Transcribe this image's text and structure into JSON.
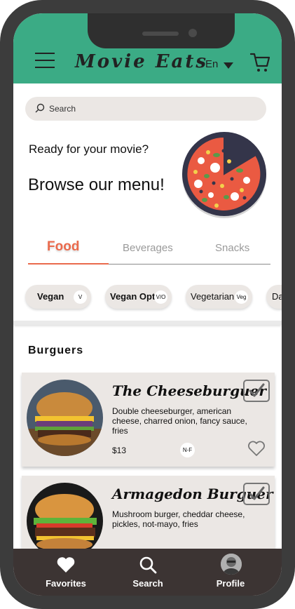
{
  "header": {
    "app_title": "Movie Eats",
    "language": "En",
    "accent_color": "#3bab85"
  },
  "search": {
    "placeholder": "Search"
  },
  "hero": {
    "greeting": "Ready for your movie?",
    "headline": "Browse our menu!",
    "image_icon": "pizza-illustration"
  },
  "tabs": [
    {
      "label": "Food",
      "active": true
    },
    {
      "label": "Beverages",
      "active": false
    },
    {
      "label": "Snacks",
      "active": false
    }
  ],
  "filters": [
    {
      "label": "Vegan",
      "badge": "V"
    },
    {
      "label": "Vegan Opt",
      "badge": "V/O"
    },
    {
      "label": "Vegetarian",
      "badge": "Veg"
    },
    {
      "label": "Da",
      "badge": ""
    }
  ],
  "section": {
    "title": "Burguers"
  },
  "items": [
    {
      "name": "The Cheeseburguer",
      "description": "Double cheeseburger, american cheese, charred onion, fancy sauce, fries",
      "price": "$13",
      "badge": "N-F",
      "selected_icon": "checkmark-icon",
      "favorite_icon": "heart-outline-icon"
    },
    {
      "name": "Armagedon Burguer",
      "description": "Mushroom burger, cheddar cheese, pickles, not-mayo, fries",
      "selected_icon": "checkmark-icon",
      "favorite_icon": "heart-outline-icon"
    }
  ],
  "bottom_nav": [
    {
      "label": "Favorites",
      "icon": "heart-icon"
    },
    {
      "label": "Search",
      "icon": "search-icon"
    },
    {
      "label": "Profile",
      "icon": "avatar"
    }
  ],
  "colors": {
    "accent": "#3bab85",
    "active_tab": "#ea6a4c",
    "nav_background": "#3c3433",
    "card_background": "#ebe7e4"
  }
}
